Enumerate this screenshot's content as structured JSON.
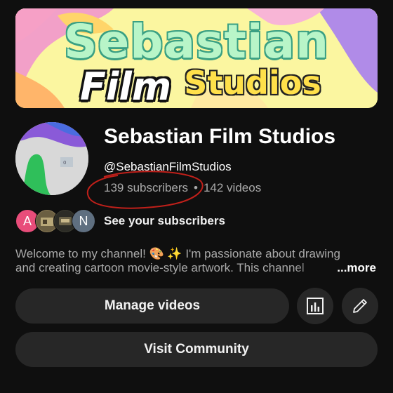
{
  "banner": {
    "line1": "Sebastian",
    "line2_film": "Film",
    "line2_studios": "Studios"
  },
  "channel": {
    "name": "Sebastian Film Studios",
    "handle": "@SebastianFilmStudios",
    "subscribers": "139 subscribers",
    "separator": "•",
    "videos": "142 videos"
  },
  "subscribers_row": {
    "avatars": [
      {
        "initial": "A",
        "color": "#e84d7a"
      },
      {
        "initial": "",
        "color": "#8a7a55"
      },
      {
        "initial": "",
        "color": "#4a4a3a"
      },
      {
        "initial": "N",
        "color": "#5f6f80"
      }
    ],
    "label": "See your subscribers"
  },
  "description": {
    "line1": "Welcome to my channel! 🎨 ✨ I'm passionate about drawing",
    "line2": "and creating cartoon movie-style artwork. This channel",
    "more_label": "...more"
  },
  "actions": {
    "manage_videos": "Manage videos",
    "analytics_icon": "bar-chart-icon",
    "edit_icon": "pencil-icon",
    "visit_community": "Visit Community"
  },
  "colors": {
    "background": "#0f0f0f",
    "button": "#272727",
    "annotation": "#c0201a"
  }
}
